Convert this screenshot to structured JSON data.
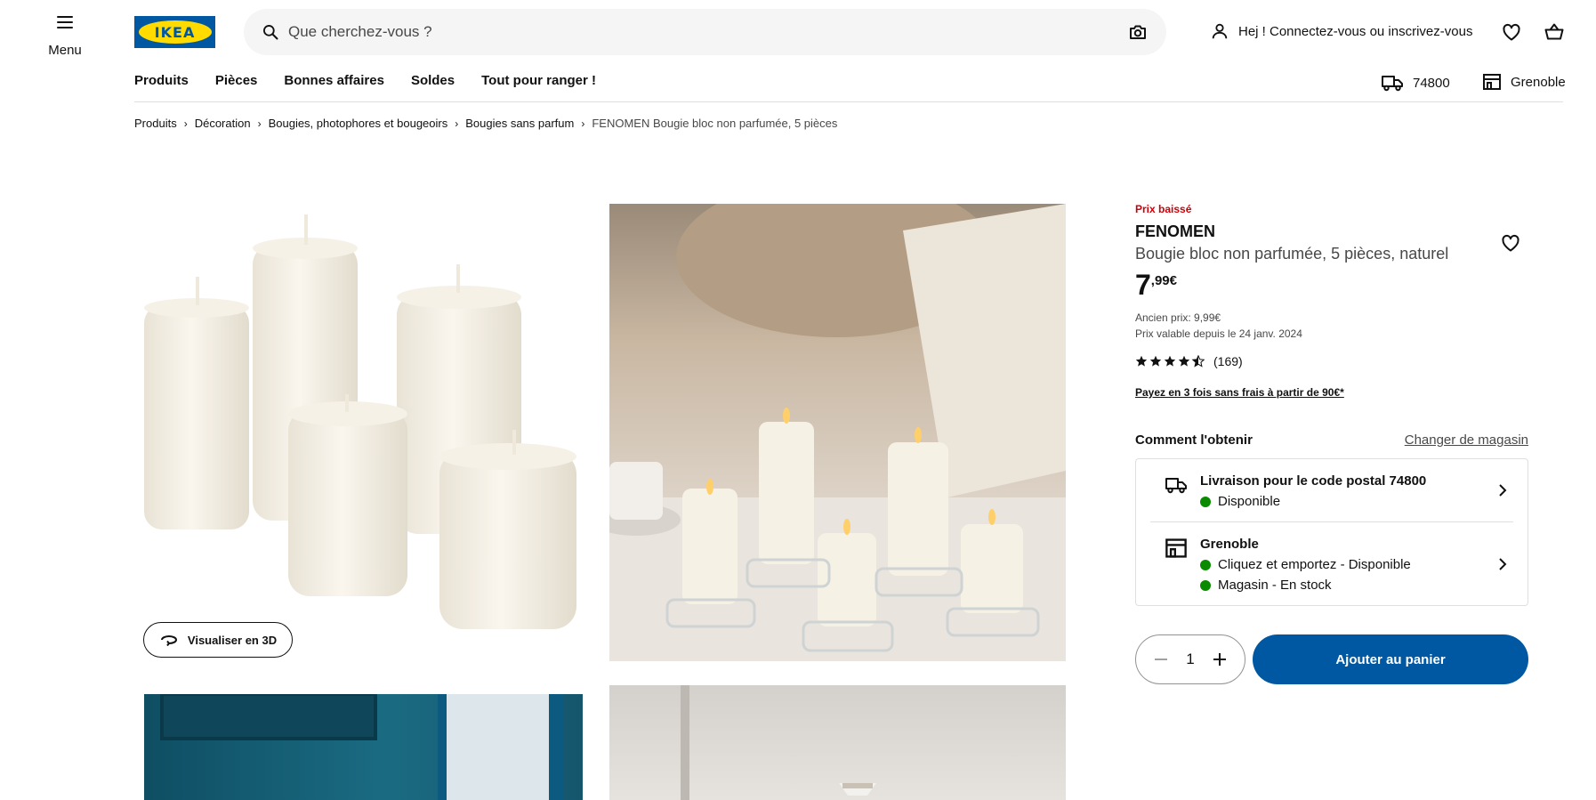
{
  "header": {
    "menu_label": "Menu",
    "logo_text": "IKEA",
    "search_placeholder": "Que cherchez-vous ?",
    "account_label": "Hej ! Connectez-vous ou inscrivez-vous"
  },
  "nav": {
    "items": [
      "Produits",
      "Pièces",
      "Bonnes affaires",
      "Soldes",
      "Tout pour ranger !"
    ],
    "postal_code": "74800",
    "store": "Grenoble"
  },
  "breadcrumb": {
    "items": [
      "Produits",
      "Décoration",
      "Bougies, photophores et bougeoirs",
      "Bougies sans parfum"
    ],
    "current": "FENOMEN Bougie bloc non parfumée, 5 pièces"
  },
  "gallery": {
    "view_3d_label": "Visualiser en 3D"
  },
  "product": {
    "badge": "Prix baissé",
    "name": "FENOMEN",
    "description": "Bougie bloc non parfumée, 5 pièces, naturel",
    "price_int": "7",
    "price_dec": ",99€",
    "old_price": "Ancien prix: 9,99€",
    "valid_since": "Prix valable depuis le 24 janv. 2024",
    "rating_value": 4.5,
    "rating_count": "(169)",
    "pay_link": "Payez en 3 fois sans frais à partir de 90€*"
  },
  "availability": {
    "title": "Comment l'obtenir",
    "change_store": "Changer de magasin",
    "delivery_title": "Livraison pour le code postal 74800",
    "delivery_status": "Disponible",
    "store_title": "Grenoble",
    "store_status_1": "Cliquez et emportez - Disponible",
    "store_status_2": "Magasin - En stock",
    "status_color": "#0a8a00"
  },
  "cart": {
    "quantity": "1",
    "add_label": "Ajouter au panier",
    "accent": "#0058a3"
  }
}
